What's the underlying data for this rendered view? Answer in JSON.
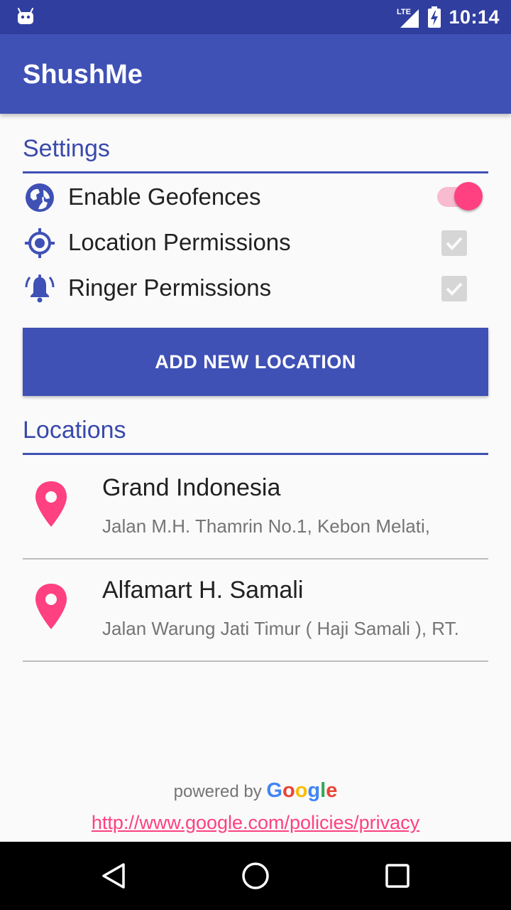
{
  "status_bar": {
    "time": "10:14",
    "network": "LTE",
    "icons": [
      "android-icon",
      "signal-icon",
      "battery-charging-icon"
    ]
  },
  "app_bar": {
    "title": "ShushMe"
  },
  "settings": {
    "header": "Settings",
    "items": [
      {
        "label": "Enable Geofences",
        "icon": "globe-icon",
        "control": "switch",
        "state": "on"
      },
      {
        "label": "Location Permissions",
        "icon": "my-location-icon",
        "control": "checkbox",
        "state": "checked-disabled"
      },
      {
        "label": "Ringer Permissions",
        "icon": "ringer-bell-icon",
        "control": "checkbox",
        "state": "checked-disabled"
      }
    ]
  },
  "add_button": {
    "label": "ADD NEW LOCATION"
  },
  "locations": {
    "header": "Locations",
    "items": [
      {
        "name": "Grand Indonesia",
        "address": "Jalan M.H. Thamrin No.1, Kebon Melati,",
        "icon": "place-pin-icon"
      },
      {
        "name": "Alfamart H. Samali",
        "address": "Jalan Warung Jati Timur ( Haji Samali ), RT.",
        "icon": "place-pin-icon"
      }
    ]
  },
  "footer": {
    "powered_by": "powered by",
    "google": [
      "G",
      "o",
      "o",
      "g",
      "l",
      "e"
    ],
    "privacy_link": "http://www.google.com/policies/privacy"
  },
  "colors": {
    "primary": "#3f51b5",
    "primary_dark": "#303f9f",
    "accent": "#ff4081"
  },
  "nav_bar": {
    "buttons": [
      "back-icon",
      "home-icon",
      "recents-icon"
    ]
  }
}
